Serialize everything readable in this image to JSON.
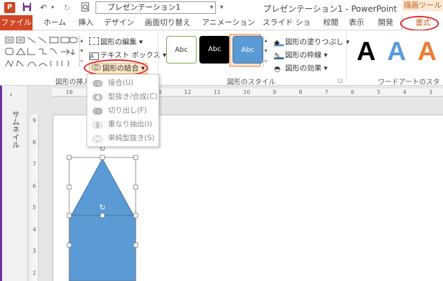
{
  "title_bar": {
    "app_icon": "P",
    "filename": "プレゼンテーション1",
    "window_title": "プレゼンテーション1 - PowerPoint",
    "context_header": "描画ツール"
  },
  "tabs": [
    {
      "label": "ファイル"
    },
    {
      "label": "ホーム"
    },
    {
      "label": "挿入"
    },
    {
      "label": "デザイン"
    },
    {
      "label": "画面切り替え"
    },
    {
      "label": "アニメーション"
    },
    {
      "label": "スライド ショー"
    },
    {
      "label": "校閲"
    },
    {
      "label": "表示"
    },
    {
      "label": "開発"
    },
    {
      "label": "書式"
    }
  ],
  "ribbon": {
    "insert_shapes": {
      "label": "図形の挿入",
      "edit_shape": "図形の編集",
      "text_box": "テキスト ボックス",
      "merge_shapes": "図形の結合"
    },
    "shape_styles": {
      "label": "図形のスタイル",
      "style_labels": [
        "Abc",
        "Abc",
        "Abc"
      ],
      "fill": "図形の塗りつぶし",
      "outline": "図形の枠線",
      "effects": "図形の効果"
    },
    "wordart": {
      "label": "ワードアートのスタイル",
      "letters": [
        "A",
        "A",
        "A"
      ]
    }
  },
  "merge_menu": [
    {
      "label": "接合(U)",
      "icon": "union-icon"
    },
    {
      "label": "型抜き/合成(C)",
      "icon": "combine-icon"
    },
    {
      "label": "切り出し(F)",
      "icon": "fragment-icon"
    },
    {
      "label": "重なり抽出(I)",
      "icon": "intersect-icon"
    },
    {
      "label": "単純型抜き(S)",
      "icon": "subtract-icon"
    }
  ],
  "ruler": {
    "h_ticks": [
      "16",
      "15",
      "14",
      "13",
      "12",
      "11",
      "10",
      "9",
      "8",
      "7",
      "6",
      "5",
      "4",
      "3"
    ],
    "v_ticks": [
      "9",
      "8",
      "7",
      "6",
      "5",
      "4",
      "3",
      "2"
    ]
  },
  "thumbnail_pane": {
    "label": "サムネイル"
  },
  "colors": {
    "accent": "#d24726",
    "shape_fill": "#5b9bd5",
    "highlight": "#e0242c",
    "context": "#c55a11"
  }
}
